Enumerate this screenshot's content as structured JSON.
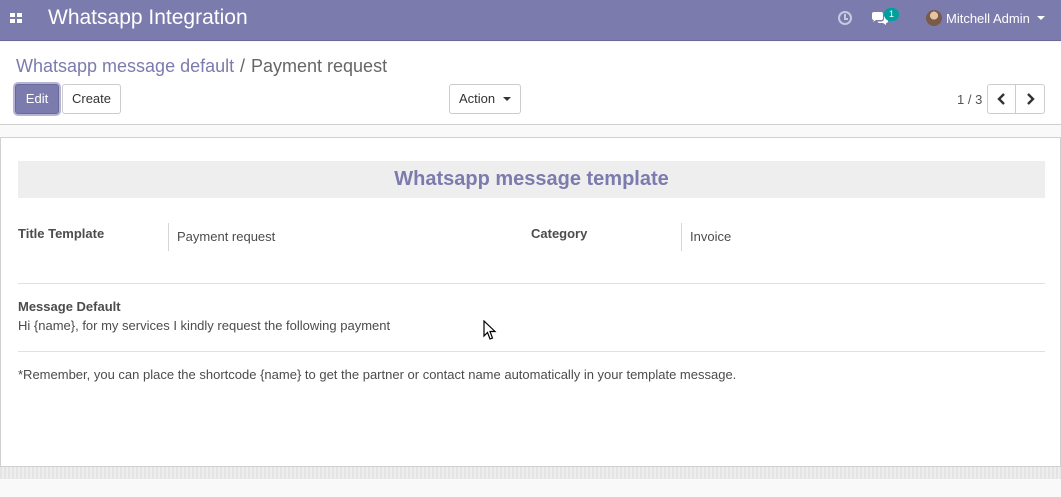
{
  "navbar": {
    "app_title": "Whatsapp Integration",
    "icons": {
      "apps": "apps-grid-icon",
      "activity": "clock-icon",
      "messages": "chat-icon"
    },
    "messages_badge": "1",
    "user_name": "Mitchell Admin",
    "bg_color": "#7c7bad"
  },
  "breadcrumb": {
    "parent": "Whatsapp message default",
    "separator": "/",
    "current": "Payment request"
  },
  "toolbar": {
    "edit_label": "Edit",
    "create_label": "Create",
    "action_label": "Action"
  },
  "pager": {
    "value": "1 / 3"
  },
  "form": {
    "header": "Whatsapp message template",
    "title_template_label": "Title Template",
    "title_template_value": "Payment request",
    "category_label": "Category",
    "category_value": "Invoice",
    "message_default_label": "Message Default",
    "message_default_value": "Hi {name}, for my services I kindly request the following payment",
    "reminder": "*Remember, you can place the shortcode {name} to get the partner or contact name automatically in your template message."
  }
}
